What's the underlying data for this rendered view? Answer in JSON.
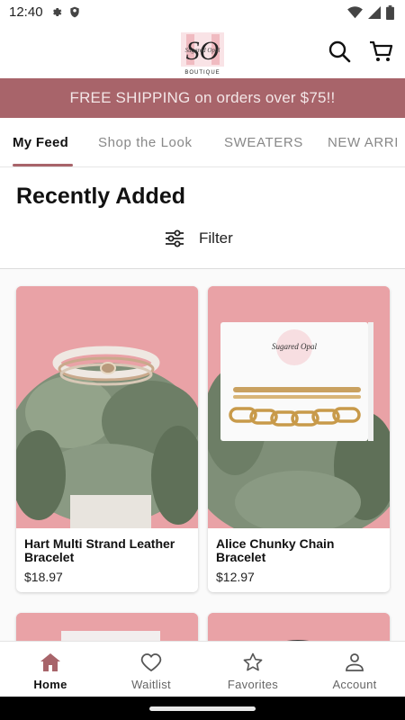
{
  "status_bar": {
    "time": "12:40"
  },
  "header": {
    "logo_text": "SO",
    "logo_script": "Sugared Opal",
    "logo_sub": "BOUTIQUE"
  },
  "banner": {
    "text": "FREE SHIPPING on orders over $75!!"
  },
  "tabs": [
    {
      "label": "My Feed",
      "active": true
    },
    {
      "label": "Shop the Look",
      "active": false
    },
    {
      "label": "SWEATERS",
      "active": false
    },
    {
      "label": "NEW ARRI",
      "active": false
    }
  ],
  "section": {
    "title": "Recently Added",
    "filter_label": "Filter"
  },
  "products": [
    {
      "name": "Hart Multi Strand Leather Bracelet",
      "price": "$18.97"
    },
    {
      "name": "Alice Chunky Chain Bracelet",
      "price": "$12.97"
    }
  ],
  "card_label": {
    "brand": "Sugared Opal"
  },
  "bottom_nav": [
    {
      "label": "Home",
      "icon": "home-icon",
      "active": true
    },
    {
      "label": "Waitlist",
      "icon": "heart-icon",
      "active": false
    },
    {
      "label": "Favorites",
      "icon": "star-icon",
      "active": false
    },
    {
      "label": "Account",
      "icon": "person-icon",
      "active": false
    }
  ],
  "colors": {
    "accent": "#a8646a",
    "banner_text": "#f3e6e7",
    "product_bg": "#e9a4a8"
  }
}
